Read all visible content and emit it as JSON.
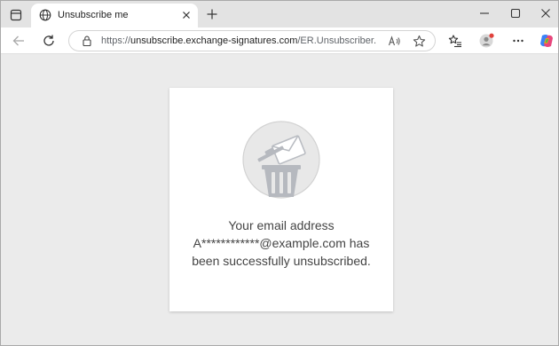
{
  "browser": {
    "tab": {
      "title": "Unsubscribe me",
      "favicon": "globe-icon"
    },
    "address": {
      "prefix": "https://",
      "host": "unsubscribe.exchange-signatures.com",
      "path": "/ER.Unsubscriber..."
    },
    "window_controls": [
      "minimize-icon",
      "maximize-icon",
      "close-icon"
    ],
    "accent_colors": {
      "profile_dot": "#e0413c",
      "copilot": "#3b82f6"
    }
  },
  "page": {
    "illustration": "unsubscribe-mail-trash-icon",
    "message": {
      "line1": "Your email address",
      "line2": "A************@example.com has",
      "line3": "been successfully unsubscribed."
    }
  }
}
